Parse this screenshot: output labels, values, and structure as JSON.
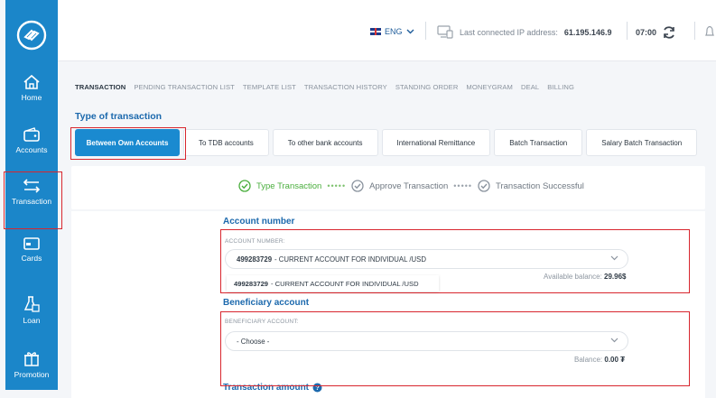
{
  "sidebar": {
    "items": [
      {
        "label": "Home",
        "icon": "home-icon"
      },
      {
        "label": "Accounts",
        "icon": "wallet-icon"
      },
      {
        "label": "Transaction",
        "icon": "transfer-arrows-icon"
      },
      {
        "label": "Cards",
        "icon": "card-icon"
      },
      {
        "label": "Loan",
        "icon": "loan-icon"
      },
      {
        "label": "Promotion",
        "icon": "gift-icon"
      }
    ]
  },
  "topbar": {
    "language": "ENG",
    "ip_label": "Last connected IP address:",
    "ip_value": "61.195.146.9",
    "time": "07:00"
  },
  "tabs": [
    "TRANSACTION",
    "PENDING TRANSACTION LIST",
    "TEMPLATE LIST",
    "TRANSACTION HISTORY",
    "STANDING ORDER",
    "MONEYGRAM",
    "DEAL",
    "BILLING"
  ],
  "type_section": {
    "title": "Type of transaction",
    "buttons": [
      "Between Own Accounts",
      "To TDB accounts",
      "To other bank accounts",
      "International Remittance",
      "Batch Transaction",
      "Salary Batch Transaction"
    ]
  },
  "steps": {
    "step1": "Type Transaction",
    "step2": "Approve Transaction",
    "step3": "Transaction Successful"
  },
  "account": {
    "title": "Account number",
    "field_label": "ACCOUNT NUMBER:",
    "selected_number": "499283729",
    "selected_desc": "- CURRENT ACCOUNT FOR INDIVIDUAL /USD",
    "option_number": "499283729",
    "option_desc": "- CURRENT ACCOUNT FOR INDIVIDUAL /USD",
    "balance_label": "Available balance:",
    "balance_value": "29.96$"
  },
  "beneficiary": {
    "title": "Beneficiary account",
    "field_label": "BENEFICIARY ACCOUNT:",
    "placeholder": "- Choose -",
    "balance_label": "Balance:",
    "balance_value": "0.00 ₮"
  },
  "amount": {
    "title": "Transaction amount"
  },
  "colors": {
    "sidebar": "#1b86c9",
    "accent": "#1c69ad",
    "highlight": "#d8262e",
    "success": "#4aae3d"
  }
}
